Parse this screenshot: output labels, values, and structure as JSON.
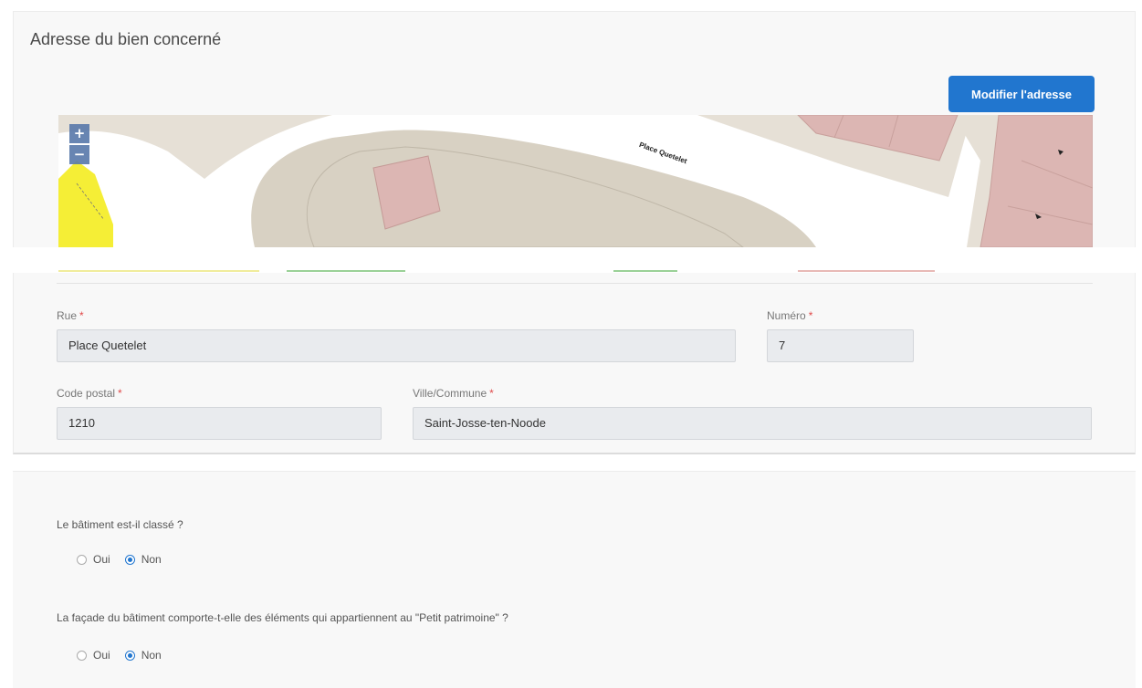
{
  "address_card": {
    "title": "Adresse du bien concerné",
    "edit_button": "Modifier l'adresse"
  },
  "map": {
    "zoom_in": "+",
    "zoom_out": "−",
    "street_label": "Place Quetelet",
    "colors": {
      "background": "#ece8e1",
      "street": "#ffffff",
      "building": "#dcb6b3",
      "highlight": "#f5ee36",
      "block": "#d8d1c3"
    }
  },
  "form": {
    "street": {
      "label": "Rue",
      "value": "Place Quetelet"
    },
    "number": {
      "label": "Numéro",
      "value": "7"
    },
    "postal_code": {
      "label": "Code postal",
      "value": "1210"
    },
    "city": {
      "label": "Ville/Commune",
      "value": "Saint-Josse-ten-Noode"
    },
    "required_marker": "*"
  },
  "questions": [
    {
      "text": "Le bâtiment est-il classé ?",
      "options": [
        {
          "label": "Oui",
          "selected": false
        },
        {
          "label": "Non",
          "selected": true
        }
      ]
    },
    {
      "text": "La façade du bâtiment comporte-t-elle des éléments qui appartiennent au \"Petit patrimoine\" ?",
      "options": [
        {
          "label": "Oui",
          "selected": false
        },
        {
          "label": "Non",
          "selected": true
        }
      ]
    }
  ],
  "colors": {
    "accent": "#2176cf",
    "required": "#e04a4a",
    "field_bg": "#e9ebee"
  }
}
